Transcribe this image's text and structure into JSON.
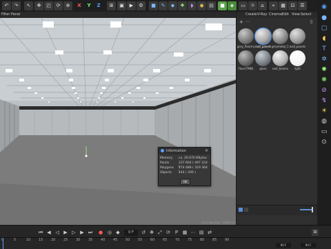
{
  "menubar": {
    "items": [
      "Filter",
      "Panel"
    ]
  },
  "toolbar": {
    "axis_labels": [
      "X",
      "Y",
      "Z"
    ],
    "icons": [
      "undo-icon",
      "redo-icon",
      "select-icon",
      "move-icon",
      "scale-icon",
      "rotate-icon",
      "coordinate-icon",
      "render-region-icon",
      "render-view-icon",
      "render-settings-icon",
      "cube-icon",
      "pen-icon",
      "polygon-icon",
      "cloner-icon",
      "bend-icon",
      "field-icon",
      "floor-icon",
      "camera-icon",
      "light-icon",
      "tag-icon",
      "brush-icon",
      "model-mode-icon",
      "points-mode-icon",
      "edges-mode-icon",
      "polygons-mode-icon",
      "snap-icon",
      "workplane-icon",
      "lock-icon",
      "layout-icon",
      "cube-icon",
      "cube-green-icon",
      "scene-icon"
    ]
  },
  "material_panel": {
    "menu": [
      "Create",
      "V-Ray",
      "Cinema",
      "Edit",
      "View",
      "Select"
    ],
    "materials": [
      {
        "label": "grey_flooring",
        "color": "#7d7d7d"
      },
      {
        "label": "roof_panels",
        "color": "#a9a9a9"
      },
      {
        "label": "greymetal_1",
        "color": "#8a8a8a"
      },
      {
        "label": "wall_panels",
        "color": "#9b9b9b"
      },
      {
        "label": "Floor(TMN)",
        "color": "#6e6e6e"
      },
      {
        "label": "glass",
        "color": "#7b8288"
      },
      {
        "label": "roof_beams",
        "color": "#b5b5b5"
      },
      {
        "label": "light",
        "color": "#f4f4f4"
      }
    ]
  },
  "info_dialog": {
    "title": "Information",
    "rows": [
      {
        "key": "Memory",
        "value": "ca. 20 670 KBytes"
      },
      {
        "key": "Points",
        "value": "237 604 ( 497 224 )"
      },
      {
        "key": "Polygons",
        "value": "274 488 ( 319 364 )"
      },
      {
        "key": "Objects",
        "value": "144 ( 200 )"
      }
    ],
    "ok_label": "OK"
  },
  "status": {
    "grid_spacing": "Grid Spacing : 10000 cm"
  },
  "timeline": {
    "ticks": [
      "0",
      "5",
      "10",
      "15",
      "20",
      "25",
      "30",
      "35",
      "40",
      "45",
      "50",
      "55",
      "60",
      "65",
      "70",
      "75",
      "80",
      "85",
      "90"
    ],
    "current_frame": "0 F",
    "start_frame": "0 F",
    "end_frame": "90 F",
    "end_frame_2": "90 F"
  }
}
